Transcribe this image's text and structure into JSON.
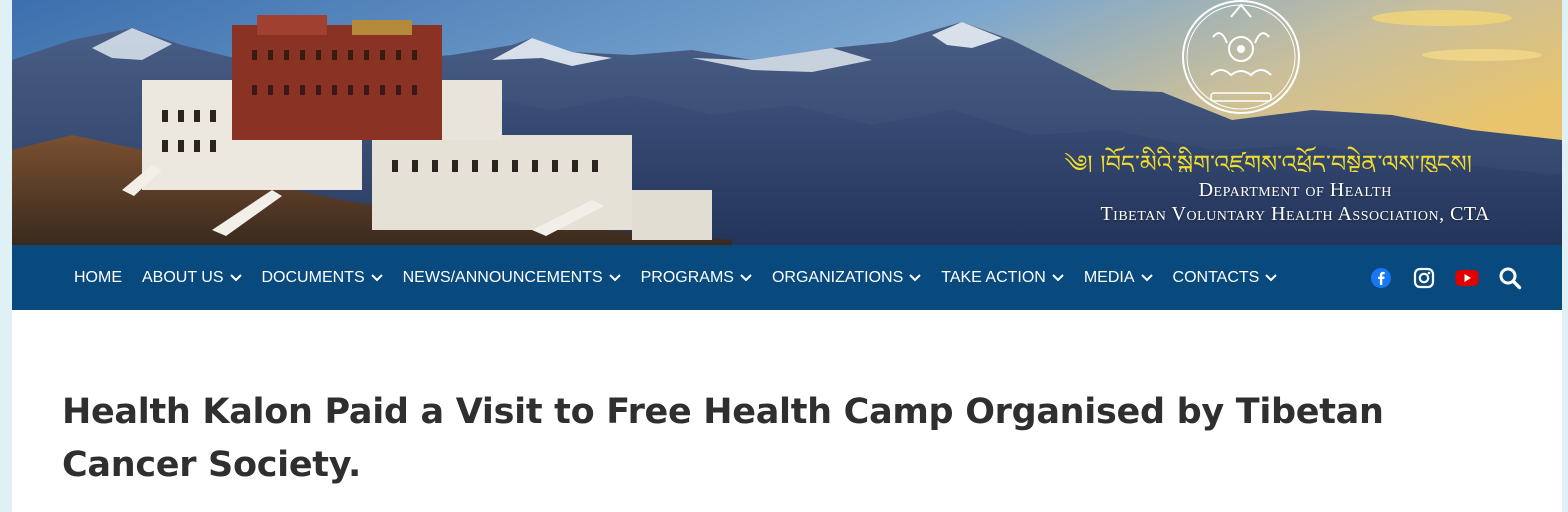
{
  "header": {
    "tibetan_title": "༄། །བོད་མིའི་སྒྲིག་འཛུགས་འཕྲོད་བསྟེན་ལས་ཁུངས།",
    "org_line1": "Department of Health",
    "org_line2": "Tibetan Voluntary Health Association, CTA"
  },
  "nav": {
    "items": [
      {
        "label": "HOME",
        "has_dropdown": false
      },
      {
        "label": "ABOUT US",
        "has_dropdown": true
      },
      {
        "label": "DOCUMENTS",
        "has_dropdown": true
      },
      {
        "label": "NEWS/ANNOUNCEMENTS",
        "has_dropdown": true
      },
      {
        "label": "PROGRAMS",
        "has_dropdown": true
      },
      {
        "label": "ORGANIZATIONS",
        "has_dropdown": true
      },
      {
        "label": "TAKE ACTION",
        "has_dropdown": true
      },
      {
        "label": "MEDIA",
        "has_dropdown": true
      },
      {
        "label": "CONTACTS",
        "has_dropdown": true
      }
    ],
    "icons": [
      "facebook-icon",
      "instagram-icon",
      "youtube-icon",
      "search-icon"
    ]
  },
  "article": {
    "title": "Health Kalon Paid a Visit to Free Health Camp Organised by Tibetan Cancer Society."
  },
  "colors": {
    "nav_bg": "#08497e",
    "page_bg": "#dff1f5",
    "facebook": "#1877f2",
    "youtube": "#e00000",
    "tibetan_text": "#f1dd2e",
    "title_text": "#2f2f2f"
  }
}
